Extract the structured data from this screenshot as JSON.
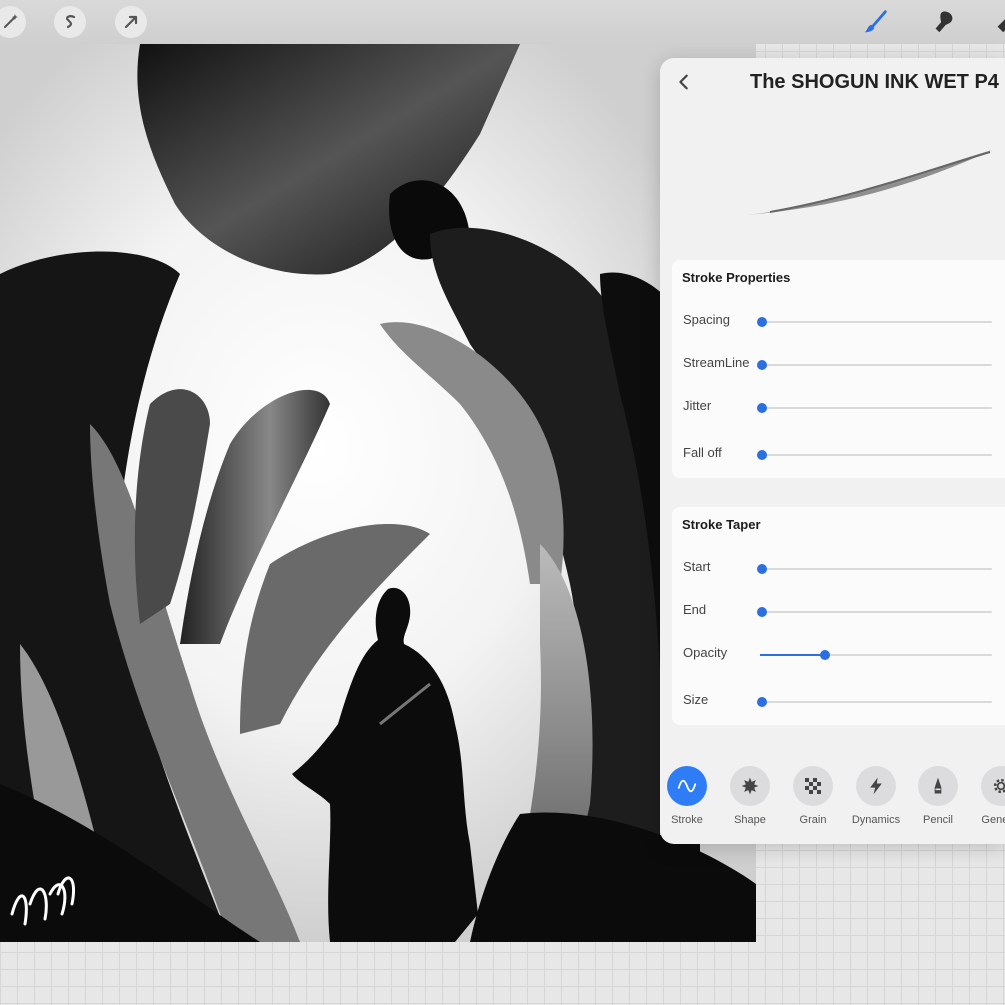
{
  "toolbar": {
    "left_icons": [
      "magic-wand-icon",
      "selection-icon",
      "transform-arrow-icon"
    ],
    "right_icons": [
      "brush-icon",
      "smudge-icon",
      "eraser-icon"
    ],
    "active_tool": "brush-icon",
    "accent": "#2b6fe0"
  },
  "panel": {
    "title": "The SHOGUN INK WET P4",
    "stroke_properties": {
      "title": "Stroke Properties",
      "rows": [
        {
          "label": "Spacing",
          "value": 0
        },
        {
          "label": "StreamLine",
          "value": 0
        },
        {
          "label": "Jitter",
          "value": 0
        },
        {
          "label": "Fall off",
          "value": 0
        }
      ]
    },
    "stroke_taper": {
      "title": "Stroke Taper",
      "rows": [
        {
          "label": "Start",
          "value": 0
        },
        {
          "label": "End",
          "value": 0
        },
        {
          "label": "Opacity",
          "value": 0.28
        },
        {
          "label": "Size",
          "value": 0
        }
      ]
    },
    "tabs": [
      {
        "label": "Stroke",
        "icon": "stroke-wave-icon",
        "active": true
      },
      {
        "label": "Shape",
        "icon": "shape-splat-icon",
        "active": false
      },
      {
        "label": "Grain",
        "icon": "grain-checker-icon",
        "active": false
      },
      {
        "label": "Dynamics",
        "icon": "dynamics-bolt-icon",
        "active": false
      },
      {
        "label": "Pencil",
        "icon": "pencil-tip-icon",
        "active": false
      },
      {
        "label": "General",
        "icon": "gear-icon",
        "active": false
      }
    ]
  },
  "artwork": {
    "signature": "signature"
  }
}
